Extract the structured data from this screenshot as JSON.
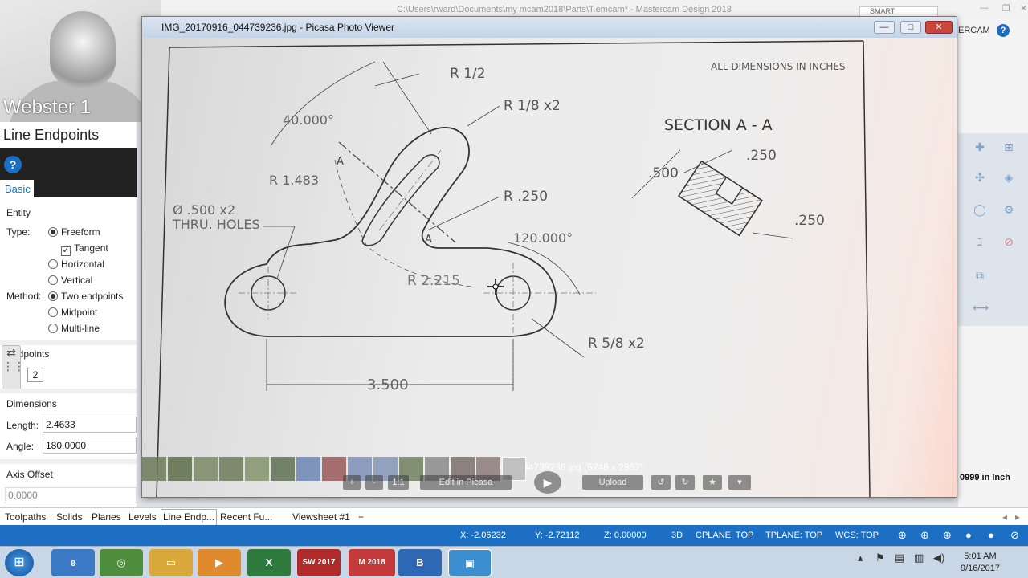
{
  "mastercam": {
    "title": "C:\\Users\\rward\\Documents\\my mcam2018\\Parts\\T.emcam* - Mastercam Design 2018",
    "smart_label": "SMART",
    "ribbon_label": "ERCAM",
    "scale_label": "0999 in Inch"
  },
  "webcam": {
    "name": "Webster 1"
  },
  "panel": {
    "title": "Line Endpoints",
    "tab": "Basic",
    "entity_label": "Entity",
    "type_label": "Type:",
    "types": [
      "Freeform",
      "Horizontal",
      "Vertical"
    ],
    "tangent_label": "Tangent",
    "method_label": "Method:",
    "methods": [
      "Two endpoints",
      "Midpoint",
      "Multi-line"
    ],
    "endpoints_label": "Endpoints",
    "endpoint_number": "2",
    "dimensions_label": "Dimensions",
    "length_label": "Length:",
    "length_value": "2.4633",
    "angle_label": "Angle:",
    "angle_value": "180.0000",
    "axis_offset_label": "Axis Offset",
    "axis_offset_value": "0.0000"
  },
  "bottom_tabs": [
    "Toolpaths",
    "Solids",
    "Planes",
    "Levels",
    "Line Endp...",
    "Recent Fu...",
    "Viewsheet #1",
    "+"
  ],
  "status": {
    "x": "X:  -2.06232",
    "y": "Y:  -2.72112",
    "z": "Z:  0.00000",
    "mode": "3D",
    "cplane": "CPLANE: TOP",
    "tplane": "TPLANE: TOP",
    "wcs": "WCS: TOP"
  },
  "picasa": {
    "title": "IMG_20170916_044739236.jpg - Picasa Photo Viewer",
    "caption": "IMG_20170916_044739236.jpg (5248 x 2952)",
    "buttons": {
      "zoom_in": "+",
      "zoom_out": "-",
      "actual": "1:1",
      "edit": "Edit in Picasa",
      "upload": "Upload"
    }
  },
  "drawing": {
    "note": "ALL DIMENSIONS IN INCHES",
    "section": "SECTION  A - A",
    "dims": {
      "r_half": "R 1/2",
      "r_eighth": "R 1/8 x2",
      "angle40": "40.000°",
      "r1483": "R 1.483",
      "holes1": "Ø .500 x2",
      "holes2": "THRU. HOLES",
      "r250": "R .250",
      "angle120": "120.000°",
      "r2215": "R 2.215",
      "r58": "R 5/8 x2",
      "len3500": "3.500",
      "sec500": ".500",
      "sec250a": ".250",
      "sec250b": ".250",
      "a1": "A",
      "a2": "A"
    }
  },
  "taskbar": {
    "apps": [
      "SW 2017",
      "M 2018",
      "B"
    ],
    "time": "5:01 AM",
    "date": "9/16/2017"
  }
}
